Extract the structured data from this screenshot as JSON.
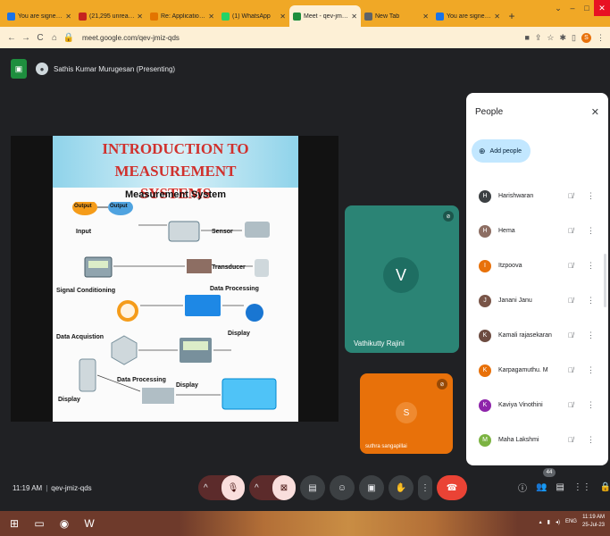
{
  "browser": {
    "tabs": [
      {
        "title": "You are signed in as o",
        "color": "#1a73e8",
        "active": false
      },
      {
        "title": "(21,295 unread) - suth",
        "color": "#c5221f",
        "active": false
      },
      {
        "title": "Re: Application for IAC",
        "color": "#e37400",
        "active": false
      },
      {
        "title": "(1) WhatsApp",
        "color": "#25d366",
        "active": false
      },
      {
        "title": "Meet - qev-jmiz-q",
        "color": "#1e8e3e",
        "active": true
      },
      {
        "title": "New Tab",
        "color": "#5f6368",
        "active": false
      },
      {
        "title": "You are signed in as o",
        "color": "#1a73e8",
        "active": false
      }
    ],
    "url": "meet.google.com/qev-jmiz-qds",
    "profile_initial": "S"
  },
  "meet": {
    "presenter_label": "Sathis Kumar Murugesan (Presenting)",
    "slide": {
      "title_line1": "INTRODUCTION TO MEASUREMENT",
      "title_line2": "SYSTEMS",
      "subtitle": "Measurement System",
      "blocks": [
        "Output",
        "Output",
        "Input",
        "Sensor",
        "Transducer",
        "Signal Conditioning",
        "Data Processing",
        "Data Acquistion",
        "Display",
        "Display",
        "Data Processing",
        "Display"
      ]
    },
    "tiles": [
      {
        "initial": "V",
        "name": "Vathikutty Rajini"
      },
      {
        "initial": "S",
        "name": "suthra sangapillai"
      }
    ],
    "people_panel": {
      "title": "People",
      "add_label": "Add people",
      "participants": [
        {
          "name": "Harishwaran",
          "initial": "H",
          "color": "#3c4043"
        },
        {
          "name": "Hema",
          "initial": "H",
          "color": "#8d6e63"
        },
        {
          "name": "Itzpoova",
          "initial": "I",
          "color": "#e8710a"
        },
        {
          "name": "Janani Janu",
          "initial": "J",
          "color": "#795548"
        },
        {
          "name": "Kamali rajasekaran",
          "initial": "K",
          "color": "#6d4c41"
        },
        {
          "name": "Karpagamuthu. M",
          "initial": "K",
          "color": "#e8710a"
        },
        {
          "name": "Kaviya Vinothini",
          "initial": "K",
          "color": "#8e24aa"
        },
        {
          "name": "Maha Lakshmi",
          "initial": "M",
          "color": "#7cb342"
        }
      ]
    },
    "bottom_bar": {
      "time": "11:19 AM",
      "meeting_code": "qev-jmiz-qds",
      "participant_count": "44"
    }
  },
  "taskbar": {
    "time": "11:19 AM",
    "date": "25-Jul-23",
    "lang": "ENG"
  },
  "colors": {
    "meet_bg": "#202124",
    "tab_strip": "#f0a826",
    "end_call": "#ea4335"
  }
}
